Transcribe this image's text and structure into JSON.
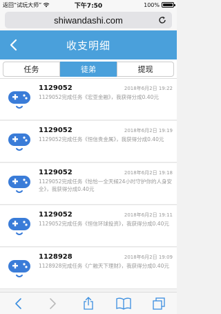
{
  "status": {
    "back_app": "返回“试玩大师”",
    "time": "下午7:50",
    "battery_text": "100%",
    "battery_level": 1.0
  },
  "browser": {
    "url": "shiwandashi.com"
  },
  "header": {
    "title": "收支明细"
  },
  "tabs": [
    {
      "label": "任务",
      "active": false
    },
    {
      "label": "徒弟",
      "active": true
    },
    {
      "label": "提现",
      "active": false
    }
  ],
  "records": [
    {
      "id": "1129052",
      "time": "2018年6月2日 19:22",
      "desc": "1129052完成任务《宏亚金融》，我获得分成0.40元"
    },
    {
      "id": "1129052",
      "time": "2018年6月2日 19:19",
      "desc": "1129052完成任务《恒信贵金属》，我获得分成0.40元"
    },
    {
      "id": "1129052",
      "time": "2018年6月2日 19:18",
      "desc": "1129052完成任务《恰恰一全天候24小时守护你的人身安全》，我获得分成0.40元"
    },
    {
      "id": "1129052",
      "time": "2018年6月2日 19:11",
      "desc": "1129052完成任务《恒信环球投资》，我获得分成0.40元"
    },
    {
      "id": "1128928",
      "time": "2018年6月2日 19:09",
      "desc": "1128928完成任务《广融天下理财》，我获得分成0.40元"
    }
  ],
  "colors": {
    "accent": "#4aa0db",
    "avatar": "#3a7cd8"
  }
}
